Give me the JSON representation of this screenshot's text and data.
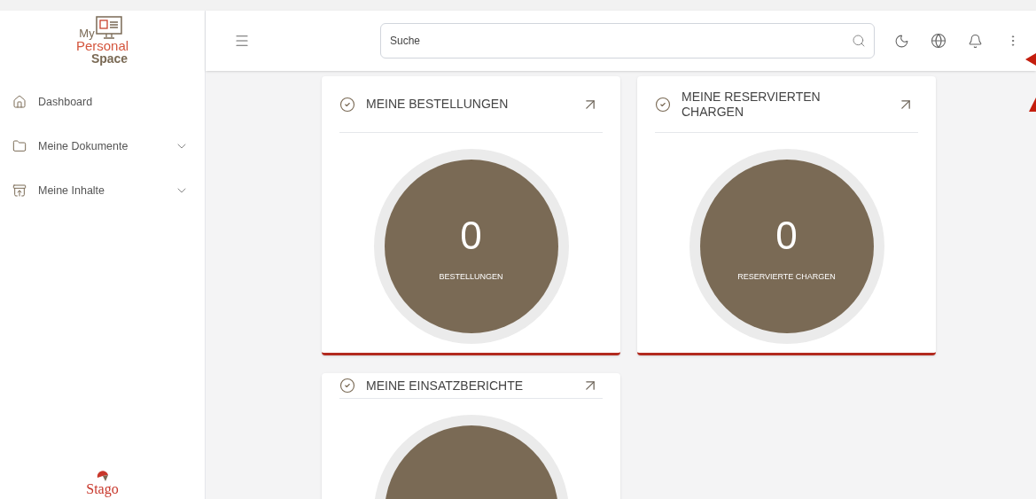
{
  "logo": {
    "line_1": "My",
    "line_2": "Personal",
    "line_3": "Space"
  },
  "sidebar": {
    "items": [
      {
        "label": "Dashboard",
        "expandable": false
      },
      {
        "label": "Meine Dokumente",
        "expandable": true
      },
      {
        "label": "Meine Inhalte",
        "expandable": true
      }
    ],
    "footer_logo": "Stago"
  },
  "search": {
    "placeholder": "Suche"
  },
  "cards": [
    {
      "title": "MEINE BESTELLUNGEN",
      "count": "0",
      "label": "BESTELLUNGEN"
    },
    {
      "title": "MEINE RESERVIERTEN CHARGEN",
      "count": "0",
      "label": "RESERVIERTE CHARGEN"
    },
    {
      "title": "MEINE EINSATZBERICHTE"
    }
  ]
}
